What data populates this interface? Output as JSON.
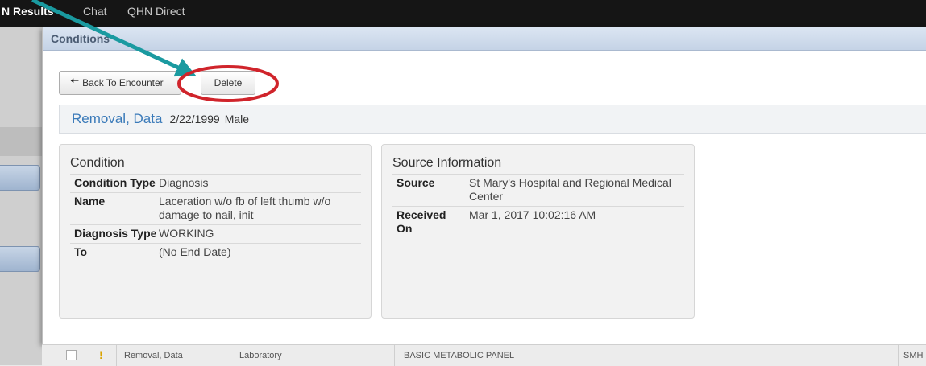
{
  "topnav": {
    "item1": "N Results",
    "item2": "Chat",
    "item3": "QHN Direct"
  },
  "modal": {
    "title": "Conditions",
    "back_button": "Back To Encounter",
    "delete_button": "Delete"
  },
  "patient": {
    "name": "Removal, Data",
    "dob": "2/22/1999",
    "sex": "Male"
  },
  "condition": {
    "heading": "Condition",
    "rows": [
      {
        "label": "Condition Type",
        "value": "Diagnosis"
      },
      {
        "label": "Name",
        "value": "Laceration w/o fb of left thumb w/o damage to nail, init"
      },
      {
        "label": "Diagnosis Type",
        "value": "WORKING"
      },
      {
        "label": "To",
        "value": "(No End Date)"
      }
    ]
  },
  "source": {
    "heading": "Source Information",
    "rows": [
      {
        "label": "Source",
        "value": "St Mary's Hospital and Regional Medical Center"
      },
      {
        "label": "Received On",
        "value": "Mar 1, 2017 10:02:16 AM"
      }
    ]
  },
  "background_row": {
    "patient": "Removal, Data",
    "category": "Laboratory",
    "test": "BASIC METABOLIC PANEL",
    "source": "SMH"
  },
  "annotation": {
    "arrow_color": "#1a9aa0",
    "circle_color": "#d0242b"
  }
}
